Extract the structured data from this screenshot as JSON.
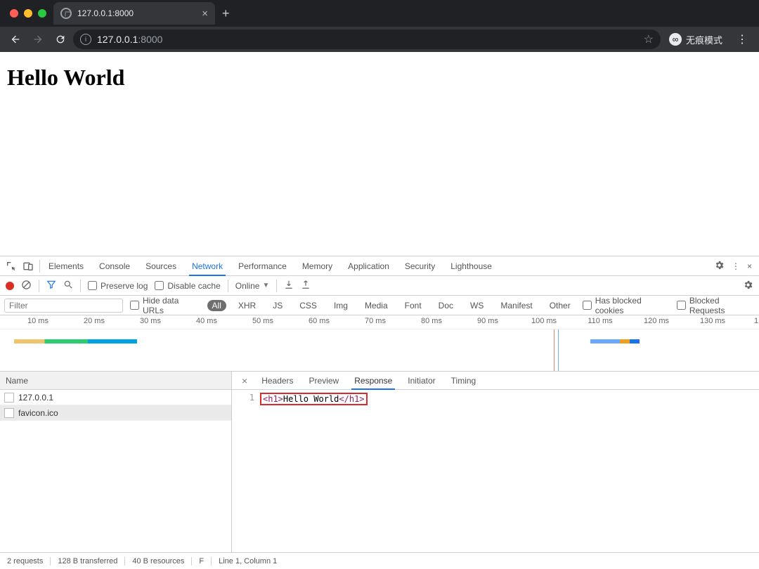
{
  "window": {
    "tab_title": "127.0.0.1:8000",
    "url_host": "127.0.0.1",
    "url_port": ":8000",
    "incognito_label": "无痕模式"
  },
  "page": {
    "heading": "Hello World"
  },
  "devtools": {
    "tabs": [
      "Elements",
      "Console",
      "Sources",
      "Network",
      "Performance",
      "Memory",
      "Application",
      "Security",
      "Lighthouse"
    ],
    "selected_tab_index": 3,
    "toolbar": {
      "preserve_log": "Preserve log",
      "disable_cache": "Disable cache",
      "throttling": "Online"
    },
    "filterbar": {
      "placeholder": "Filter",
      "hide_data_urls": "Hide data URLs",
      "types": [
        "All",
        "XHR",
        "JS",
        "CSS",
        "Img",
        "Media",
        "Font",
        "Doc",
        "WS",
        "Manifest",
        "Other"
      ],
      "selected_type_index": 0,
      "has_blocked_cookies": "Has blocked cookies",
      "blocked_requests": "Blocked Requests"
    },
    "timeline": {
      "ticks": [
        "10 ms",
        "20 ms",
        "30 ms",
        "40 ms",
        "50 ms",
        "60 ms",
        "70 ms",
        "80 ms",
        "90 ms",
        "100 ms",
        "110 ms",
        "120 ms",
        "130 ms",
        "1"
      ]
    },
    "requests": {
      "header": "Name",
      "items": [
        "127.0.0.1",
        "favicon.ico"
      ],
      "selected_index": 1
    },
    "detail": {
      "tabs": [
        "Headers",
        "Preview",
        "Response",
        "Initiator",
        "Timing"
      ],
      "selected_index": 2,
      "response_line_no": "1",
      "response_open": "<h1>",
      "response_text": "Hello World",
      "response_close": "</h1>"
    },
    "status": {
      "requests": "2 requests",
      "transferred": "128 B transferred",
      "resources": "40 B resources",
      "finish_prefix": "F",
      "cursor": "Line 1, Column 1"
    }
  }
}
